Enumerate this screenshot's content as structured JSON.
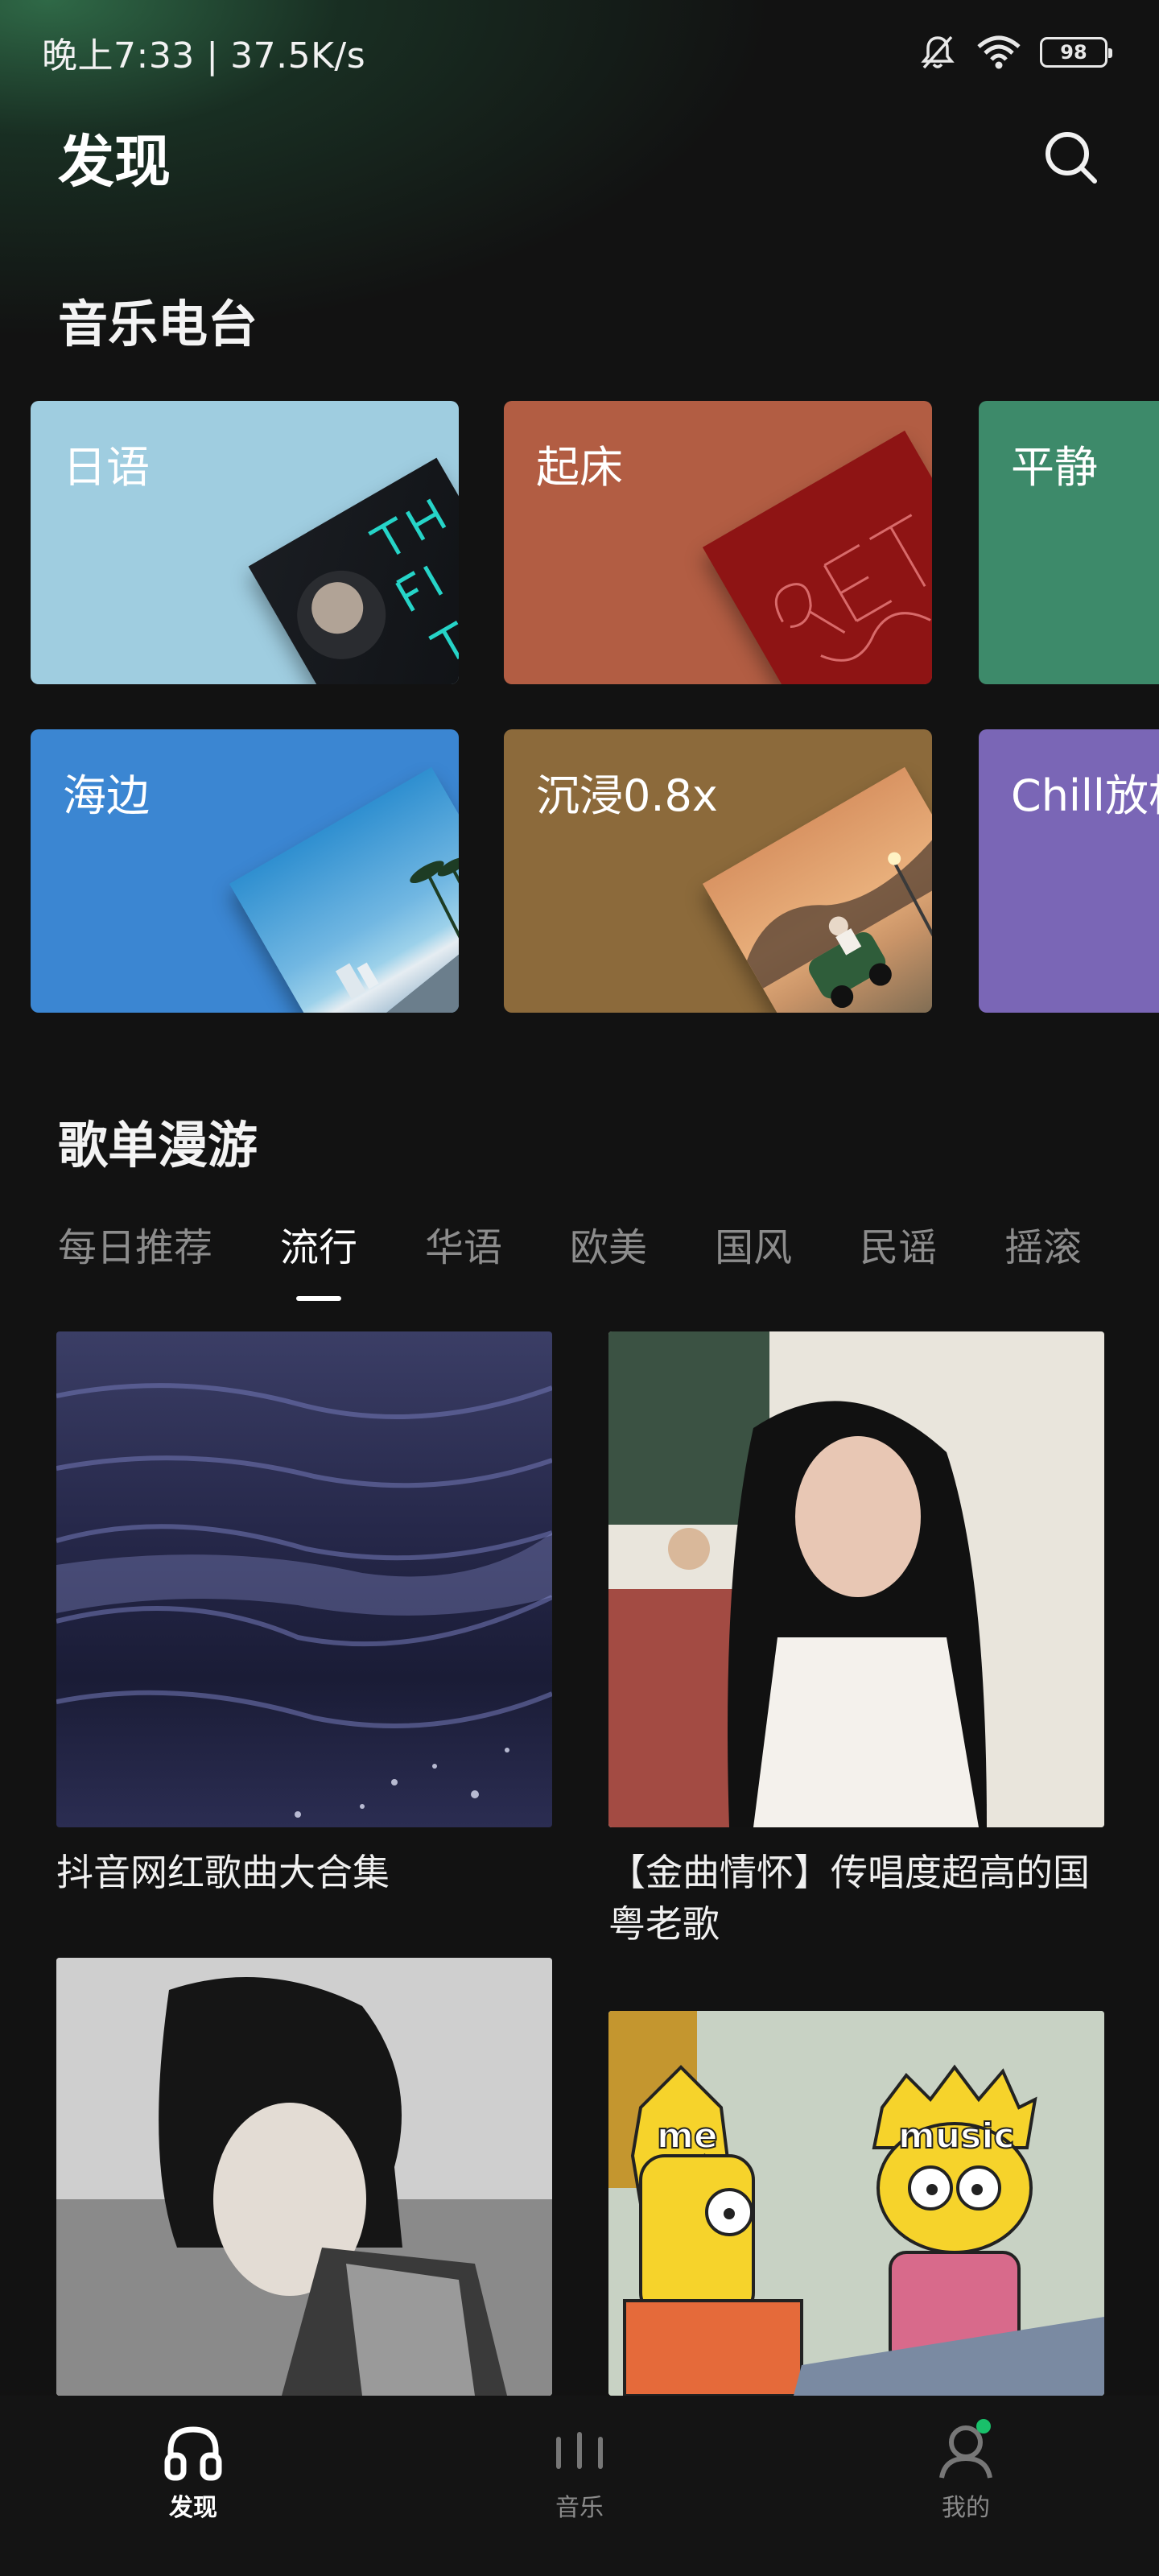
{
  "status_bar": {
    "time_speed": "晚上7:33 | 37.5K/s",
    "battery": "98",
    "icons": [
      "mute-bell-icon",
      "wifi-icon",
      "battery-icon"
    ]
  },
  "header": {
    "title": "发现",
    "search_icon": "search-icon"
  },
  "radio_section": {
    "title": "音乐电台",
    "cards": [
      {
        "label": "日语",
        "color": "#9fcde0"
      },
      {
        "label": "起床",
        "color": "#b25d43"
      },
      {
        "label": "平静",
        "color": "#3d8a6a"
      },
      {
        "label": "海边",
        "color": "#3b86d2"
      },
      {
        "label": "沉浸0.8x",
        "color": "#8c6a3b"
      },
      {
        "label": "Chill放松",
        "color": "#7a66b6"
      }
    ]
  },
  "playlist_section": {
    "title": "歌单漫游",
    "tabs": [
      "每日推荐",
      "流行",
      "华语",
      "欧美",
      "国风",
      "民谣",
      "摇滚"
    ],
    "active_tab": "流行",
    "playlists": [
      {
        "title": "抖音网红歌曲大合集"
      },
      {
        "title": "【金曲情怀】传唱度超高的国粤老歌"
      }
    ],
    "cover_text": {
      "me": "me",
      "music": "music"
    }
  },
  "bottom_nav": {
    "items": [
      {
        "label": "发现",
        "icon": "headphones-icon",
        "active": true
      },
      {
        "label": "音乐",
        "icon": "music-bars-icon",
        "active": false
      },
      {
        "label": "我的",
        "icon": "user-icon",
        "active": false
      }
    ],
    "notification_color": "#19c06a"
  },
  "colors": {
    "background": "#121212",
    "accent_green": "#19c06a"
  }
}
